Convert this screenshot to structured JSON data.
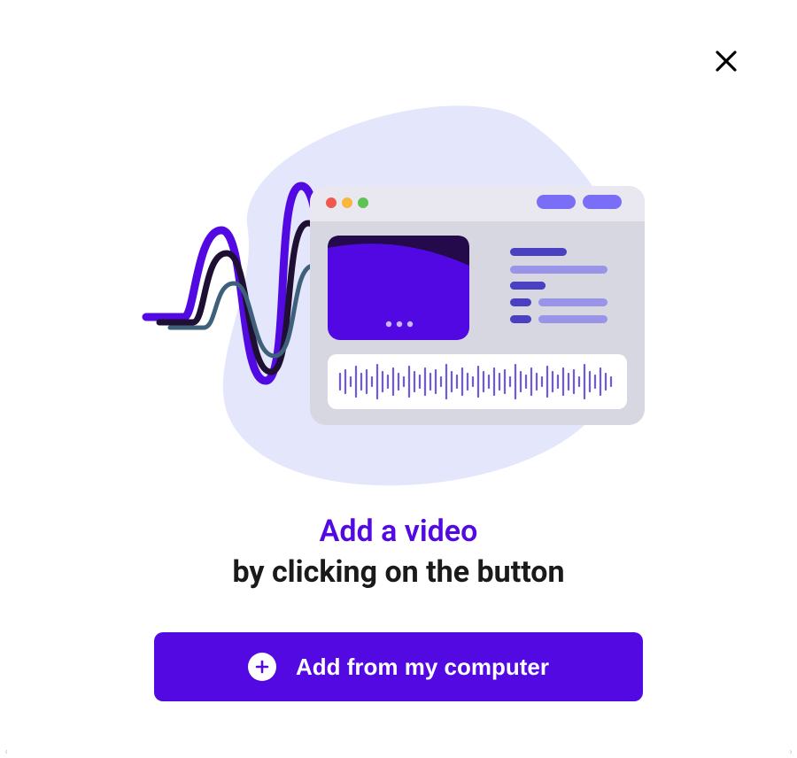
{
  "modal": {
    "close_aria": "Close",
    "headline_primary": "Add a video",
    "headline_secondary": "by clicking on the button",
    "add_button_label": "Add from my computer"
  },
  "colors": {
    "accent": "#5209E2",
    "accent_light": "#7B6EF6",
    "blob": "#E4E6FB",
    "window": "#D7D7E1",
    "window_header": "#E9E8F0",
    "video": "#5108E2",
    "video_dark": "#240A4A"
  }
}
